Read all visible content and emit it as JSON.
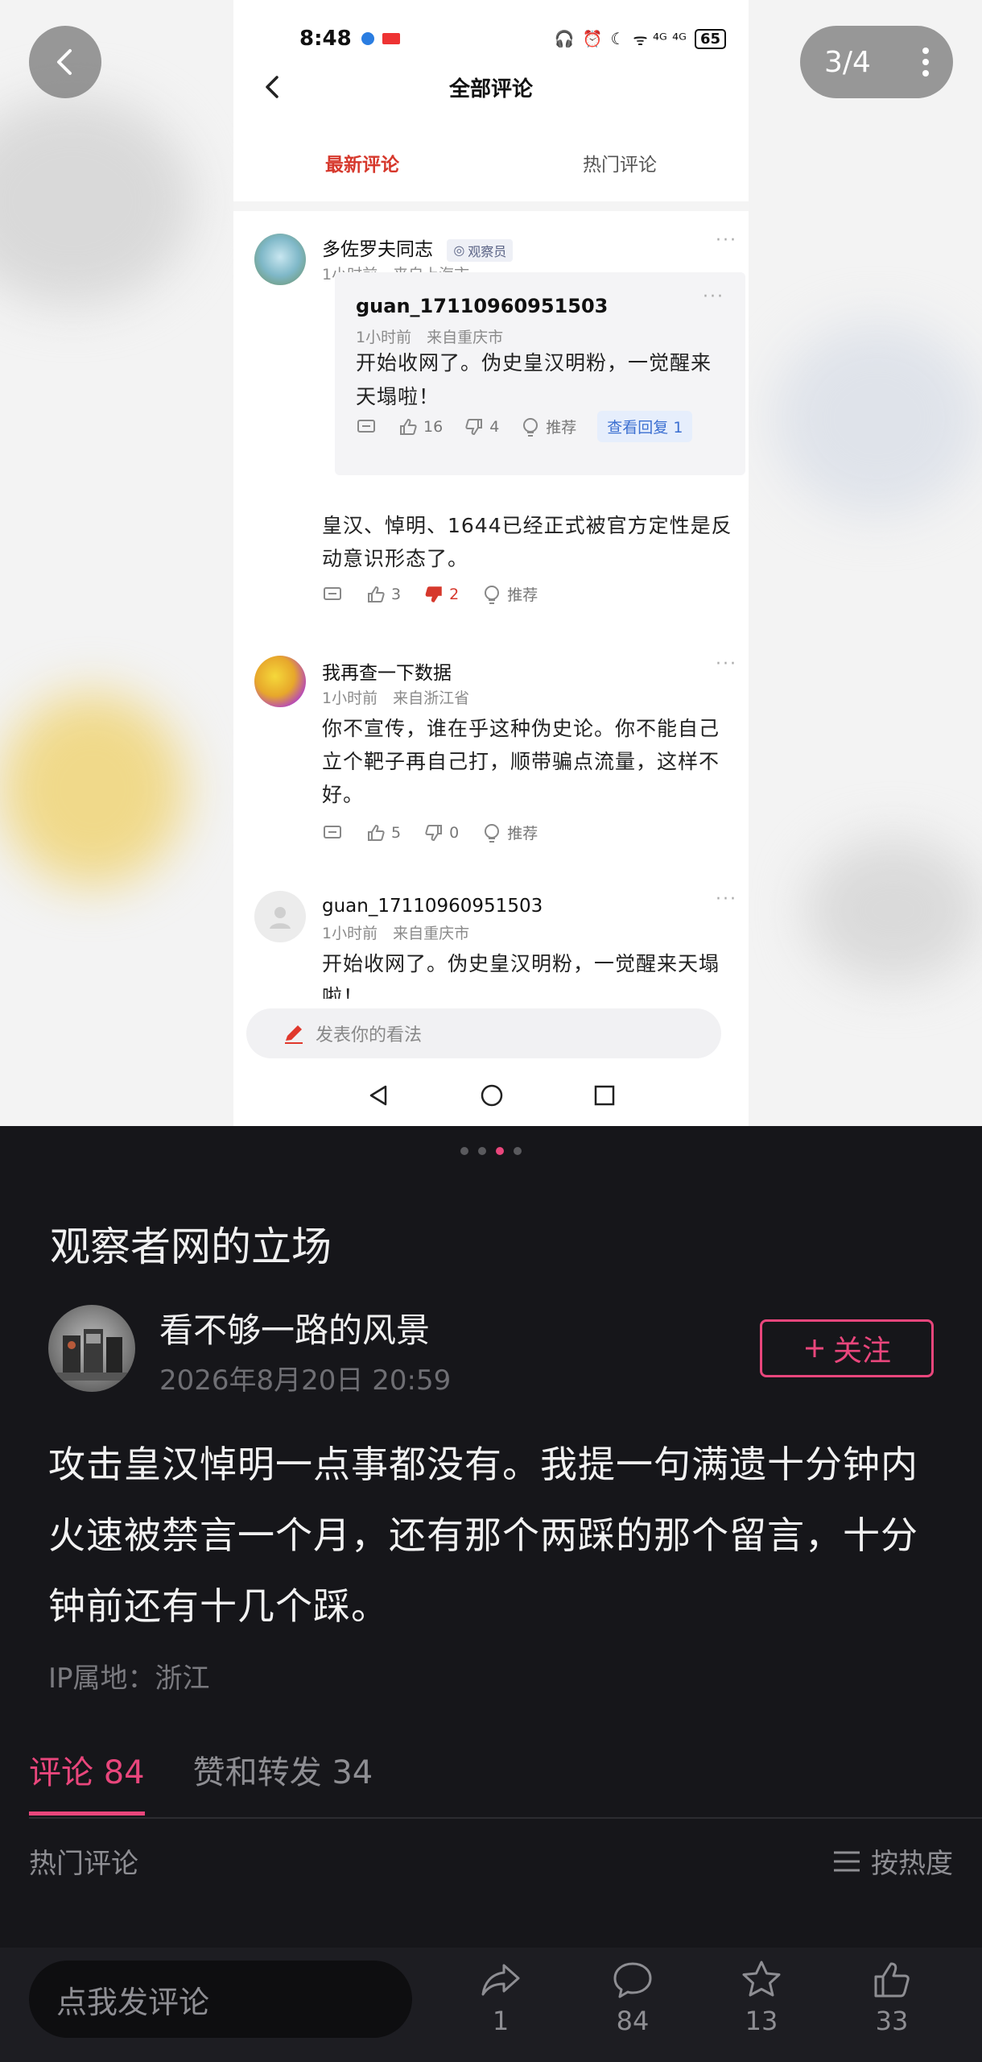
{
  "viewer": {
    "page_indicator": "3/4",
    "carousel": {
      "total": 4,
      "active_index": 2
    }
  },
  "phone": {
    "status_time": "8:48",
    "status_icons": "ᯤ ⁴ᴳ ⁴ᴳ",
    "battery": "65",
    "nav_title": "全部评论",
    "tabs": [
      "最新评论",
      "热门评论"
    ],
    "comments": [
      {
        "name": "多佐罗夫同志",
        "badge": "观察员",
        "meta": "1小时前　来自上海市",
        "reply": {
          "name": "guan_17110960951503",
          "meta": "1小时前　来自重庆市",
          "body": "开始收网了。伪史皇汉明粉，一觉醒来天塌啦！",
          "likes": "16",
          "dislikes": "4",
          "recommend": "推荐",
          "view_reply": "查看回复 1"
        },
        "body": "皇汉、悼明、1644已经正式被官方定性是反动意识形态了。",
        "likes": "3",
        "dislikes": "2",
        "recommend": "推荐"
      },
      {
        "name": "我再查一下数据",
        "meta": "1小时前　来自浙江省",
        "body": "你不宣传，谁在乎这种伪史论。你不能自己立个靶子再自己打，顺带骗点流量，这样不好。",
        "likes": "5",
        "dislikes": "0",
        "recommend": "推荐"
      },
      {
        "name": "guan_17110960951503",
        "meta": "1小时前　来自重庆市",
        "body": "开始收网了。伪史皇汉明粉，一觉醒来天塌啦！"
      }
    ],
    "input_placeholder": "发表你的看法"
  },
  "post": {
    "title": "观察者网的立场",
    "author": "看不够一路的风景",
    "date": "2026年8月20日 20:59",
    "follow_label": "关注",
    "body": "攻击皇汉悼明一点事都没有。我提一句满遗十分钟内火速被禁言一个月，还有那个两踩的那个留言，十分钟前还有十几个踩。",
    "ip_location": "IP属地：浙江"
  },
  "tabs": {
    "comments": "评论 84",
    "likes_shares": "赞和转发 34"
  },
  "comment_section": {
    "hot_label": "热门评论",
    "sort_label": "按热度"
  },
  "bottom_bar": {
    "comment_placeholder": "点我发评论",
    "share_count": "1",
    "comment_count": "84",
    "favorite_count": "13",
    "like_count": "33"
  },
  "colors": {
    "accent": "#e9467c",
    "phone_accent": "#d6382c",
    "background": "#16161a"
  }
}
